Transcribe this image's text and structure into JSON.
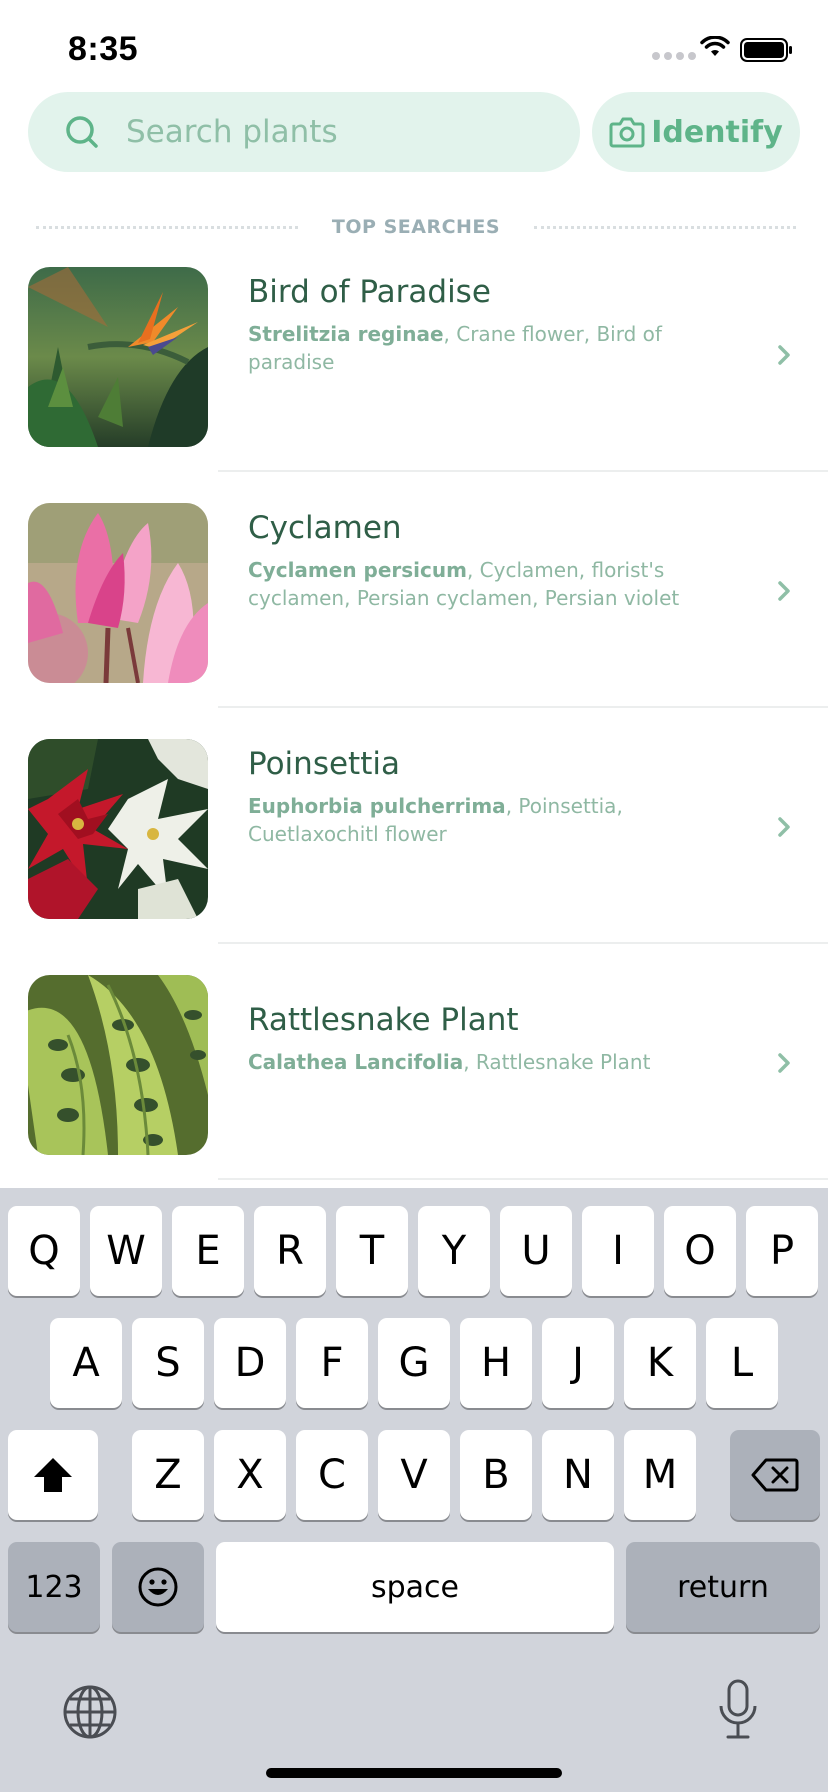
{
  "status_bar": {
    "time": "8:35"
  },
  "search": {
    "placeholder": "Search plants",
    "value": ""
  },
  "identify": {
    "label": "Identify"
  },
  "section": {
    "title": "TOP SEARCHES"
  },
  "plants": [
    {
      "name": "Bird of Paradise",
      "scientific": "Strelitzia reginae",
      "aliases": ", Crane flower, Bird of paradise",
      "image_icon": "bird-of-paradise-photo"
    },
    {
      "name": "Cyclamen",
      "scientific": "Cyclamen persicum",
      "aliases": ", Cyclamen, florist's cyclamen, Persian cyclamen, Persian violet",
      "image_icon": "cyclamen-photo"
    },
    {
      "name": "Poinsettia",
      "scientific": "Euphorbia pulcherrima",
      "aliases": ", Poinsettia, Cuetlaxochitl flower",
      "image_icon": "poinsettia-photo"
    },
    {
      "name": "Rattlesnake Plant",
      "scientific": "Calathea Lancifolia",
      "aliases": ", Rattlesnake Plant",
      "image_icon": "rattlesnake-plant-photo"
    }
  ],
  "keyboard": {
    "row1": [
      "Q",
      "W",
      "E",
      "R",
      "T",
      "Y",
      "U",
      "I",
      "O",
      "P"
    ],
    "row2": [
      "A",
      "S",
      "D",
      "F",
      "G",
      "H",
      "J",
      "K",
      "L"
    ],
    "row3": [
      "Z",
      "X",
      "C",
      "V",
      "B",
      "N",
      "M"
    ],
    "numbers_label": "123",
    "space_label": "space",
    "return_label": "return"
  },
  "colors": {
    "accent": "#5eb489",
    "accent_bg": "#e2f3ec",
    "title": "#2f5e47",
    "subtitle": "#8fb8a3"
  }
}
